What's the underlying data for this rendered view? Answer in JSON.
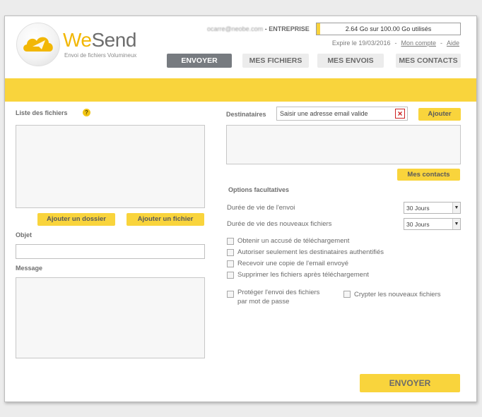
{
  "header": {
    "logo_we": "We",
    "logo_send": "Send",
    "logo_sub": "Envoi de fichiers Volumineux",
    "account_email": "ocarre@neobe.com",
    "account_sep": " - ",
    "account_type": "ENTREPRISE",
    "quota_text": "2.64 Go sur 100.00 Go utilisés",
    "quota_used_fraction": 0.0264,
    "expire_text": "Expire le 19/03/2016",
    "link_account": "Mon compte",
    "link_help": "Aide",
    "dash": "-"
  },
  "nav": {
    "send": "ENVOYER",
    "files": "MES FICHIERS",
    "sends": "MES ENVOIS",
    "contacts": "MES CONTACTS",
    "active": "ENVOYER"
  },
  "left": {
    "files_label": "Liste des fichiers",
    "help_glyph": "?",
    "add_folder": "Ajouter un dossier",
    "add_file": "Ajouter un fichier",
    "subject_label": "Objet",
    "subject_value": "",
    "message_label": "Message",
    "message_value": ""
  },
  "right": {
    "recipients_label": "Destinataires",
    "email_value": "Saisir une adresse email valide",
    "clear_glyph": "×",
    "add": "Ajouter",
    "my_contacts": "Mes contacts",
    "options_title": "Options facultatives",
    "lifetime_label": "Durée de vie de l'envoi",
    "lifetime_value": "30 Jours",
    "new_files_lifetime_label": "Durée de vie des nouveaux fichiers",
    "new_files_lifetime_value": "30 Jours",
    "select_arrow": "▼",
    "options": [
      "Obtenir un accusé de téléchargement",
      "Autoriser seulement les destinataires authentifiés",
      "Recevoir une copie de l'email envoyé",
      "Supprimer les fichiers après téléchargement"
    ],
    "protect_line1": "Protéger l'envoi des fichiers",
    "protect_line2": "par mot de passe",
    "encrypt": "Crypter les nouveaux fichiers",
    "send_button": "ENVOYER"
  },
  "colors": {
    "accent": "#f9d43c",
    "logo_yellow": "#f2b705",
    "nav_active": "#777b80"
  }
}
